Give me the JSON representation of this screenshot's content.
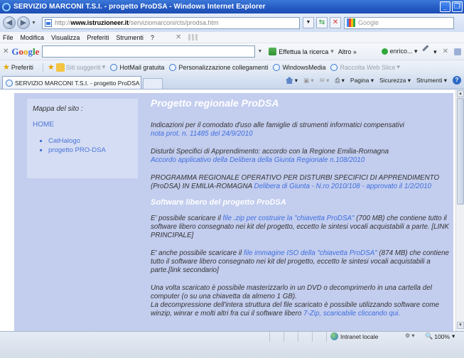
{
  "window": {
    "title": "SERVIZIO MARCONI T.S.I. - progetto ProDSA - Windows Internet Explorer"
  },
  "address": {
    "url_http": "http://",
    "url_host": "www.istruzioneer.it",
    "url_path": "/serviziomarconi/cts/prodsa.htm",
    "search_placeholder": "Google"
  },
  "menu": {
    "items": [
      "File",
      "Modifica",
      "Visualizza",
      "Preferiti",
      "Strumenti",
      "?"
    ]
  },
  "google_toolbar": {
    "label": "Google",
    "search_button": "Effettua la ricerca",
    "more": "Altro »",
    "user": "enrico..."
  },
  "favorites": {
    "label": "Preferiti",
    "suggested": "Siti suggeriti",
    "items": [
      "HotMail gratuita",
      "Personalizzazione collegamenti",
      "WindowsMedia"
    ],
    "webslice": "Raccolta Web Slice"
  },
  "tab": {
    "label": "SERVIZIO MARCONI T.S.I. - progetto ProDSA"
  },
  "commands": {
    "page": "Pagina",
    "security": "Sicurezza",
    "tools": "Strumenti"
  },
  "sidebar": {
    "title": "Mappa del sito :",
    "home": "HOME",
    "links": [
      "CatHalogo",
      "progetto PRO-DSA"
    ]
  },
  "content": {
    "heading": "Progetto regionale ProDSA",
    "p1_text": "Indicazioni per il comodato d'uso alle famiglie di strumenti informatici compensativi",
    "p1_link": "nota prot. n. 11485 del 24/9/2010",
    "p2_text": "Disturbi Specifici di Apprendimento: accordo con la Regione Emilia-Romagna",
    "p2_link": "Accordo applicativo della Delibera della Giunta Regionale n.108/2010",
    "p3_text": "PROGRAMMA REGIONALE OPERATIVO PER DISTURBI SPECIFICI DI APPRENDIMENTO (ProDSA) IN EMILIA-ROMAGNA",
    "p3_link": "Delibera di Giunta - N.ro 2010/108 - approvato il 1/2/2010",
    "subheading": "Software libero del progetto ProDSA",
    "p4_a": "E' possibile scaricare il",
    "p4_link": "file .zip per costruire la \"chiavetta ProDSA\"",
    "p4_b": "(700 MB) che contiene tutto il software libero consegnato nei kit del progetto, eccetto le sintesi vocali acquistabili a parte. [LINK PRINCIPALE]",
    "p5_a": "E' anche possibile scaricare il",
    "p5_link": "file immagine ISO della \"chiavetta ProDSA\"",
    "p5_b": "(874 MB) che contiene tutto il software libero consegnato nei kit del progetto, eccetto le sintesi vocali acquistabili a parte.[link secondario]",
    "p6_a": "Una volta scaricato è possibile masterizzarlo in un DVD o decomprimerlo in una cartella del computer (o su una chiavetta da almeno 1 GB).",
    "p6_b": "La decompressione dell'intera struttura del file scaricato è possibile utilizzando software come winzip, winrar e molti altri fra cui il software libero",
    "p6_link": "7-Zip, scaricabile cliccando qui."
  },
  "status": {
    "zone": "Intranet locale",
    "zoom": "100%"
  },
  "colors": {
    "page_bg": "#c3cdee",
    "sidebar_bg": "#d5ddf4",
    "link": "#3e6fe0",
    "titlebar": "#2559c2"
  }
}
